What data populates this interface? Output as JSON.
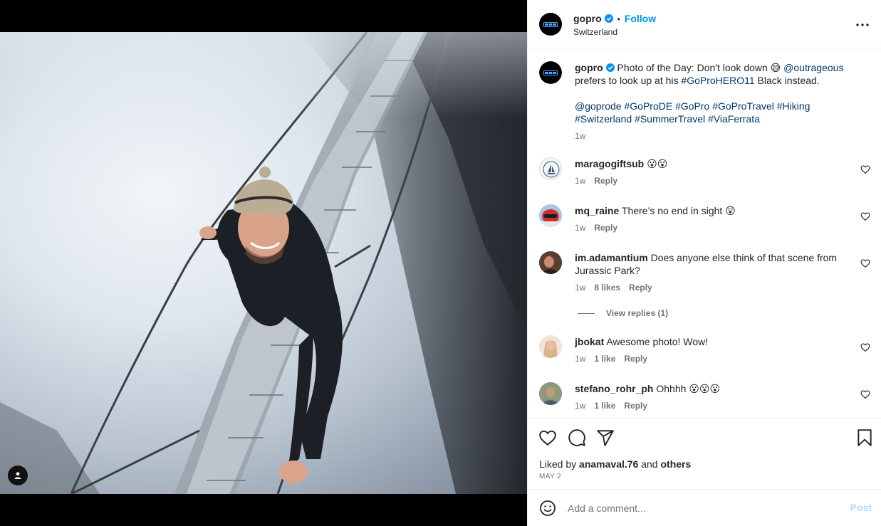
{
  "post": {
    "username": "gopro",
    "location": "Switzerland",
    "follow_label": "Follow",
    "dot": "•"
  },
  "caption": {
    "username": "gopro",
    "text_1": "Photo of the Day: Don't look down 😅",
    "mention_1": "@outrageous",
    "text_2": "prefers to look up at his",
    "hashtag_1": "#GoProHERO11",
    "text_3": "Black instead.",
    "tags_line_1": [
      "@goprode",
      "#GoProDE",
      "#GoPro",
      "#GoProTravel",
      "#Hiking"
    ],
    "tags_line_2": [
      "#Switzerland",
      "#SummerTravel",
      "#ViaFerrata"
    ],
    "time": "1w"
  },
  "comments": [
    {
      "username": "maragogiftsub",
      "text": "😮😮",
      "time": "1w",
      "likes": "",
      "reply": "Reply"
    },
    {
      "username": "mq_raine",
      "text": "There’s no end in sight 😲",
      "time": "1w",
      "likes": "",
      "reply": "Reply"
    },
    {
      "username": "im.adamantium",
      "text": "Does anyone else think of that scene from Jurassic Park?",
      "time": "1w",
      "likes": "8 likes",
      "reply": "Reply"
    },
    {
      "username": "jbokat",
      "text": "Awesome photo! Wow!",
      "time": "1w",
      "likes": "1 like",
      "reply": "Reply"
    },
    {
      "username": "stefano_rohr_ph",
      "text": "Ohhhh 😮😮😮",
      "time": "1w",
      "likes": "1 like",
      "reply": "Reply"
    }
  ],
  "view_replies": "View replies (1)",
  "liked_by": {
    "prefix": "Liked by",
    "user": "anamaval.76",
    "and": "and",
    "others": "others"
  },
  "date": "MAY 2",
  "comment_input": {
    "placeholder": "Add a comment...",
    "post_label": "Post"
  },
  "colors": {
    "link": "#00376b",
    "follow": "#0095f6",
    "verified": "#0095f6",
    "post_disabled": "#b3dbff"
  },
  "icons": [
    "user-tag-icon",
    "more-options-icon",
    "verified-badge-icon",
    "heart-icon",
    "comment-icon",
    "share-icon",
    "bookmark-icon",
    "emoji-icon"
  ]
}
